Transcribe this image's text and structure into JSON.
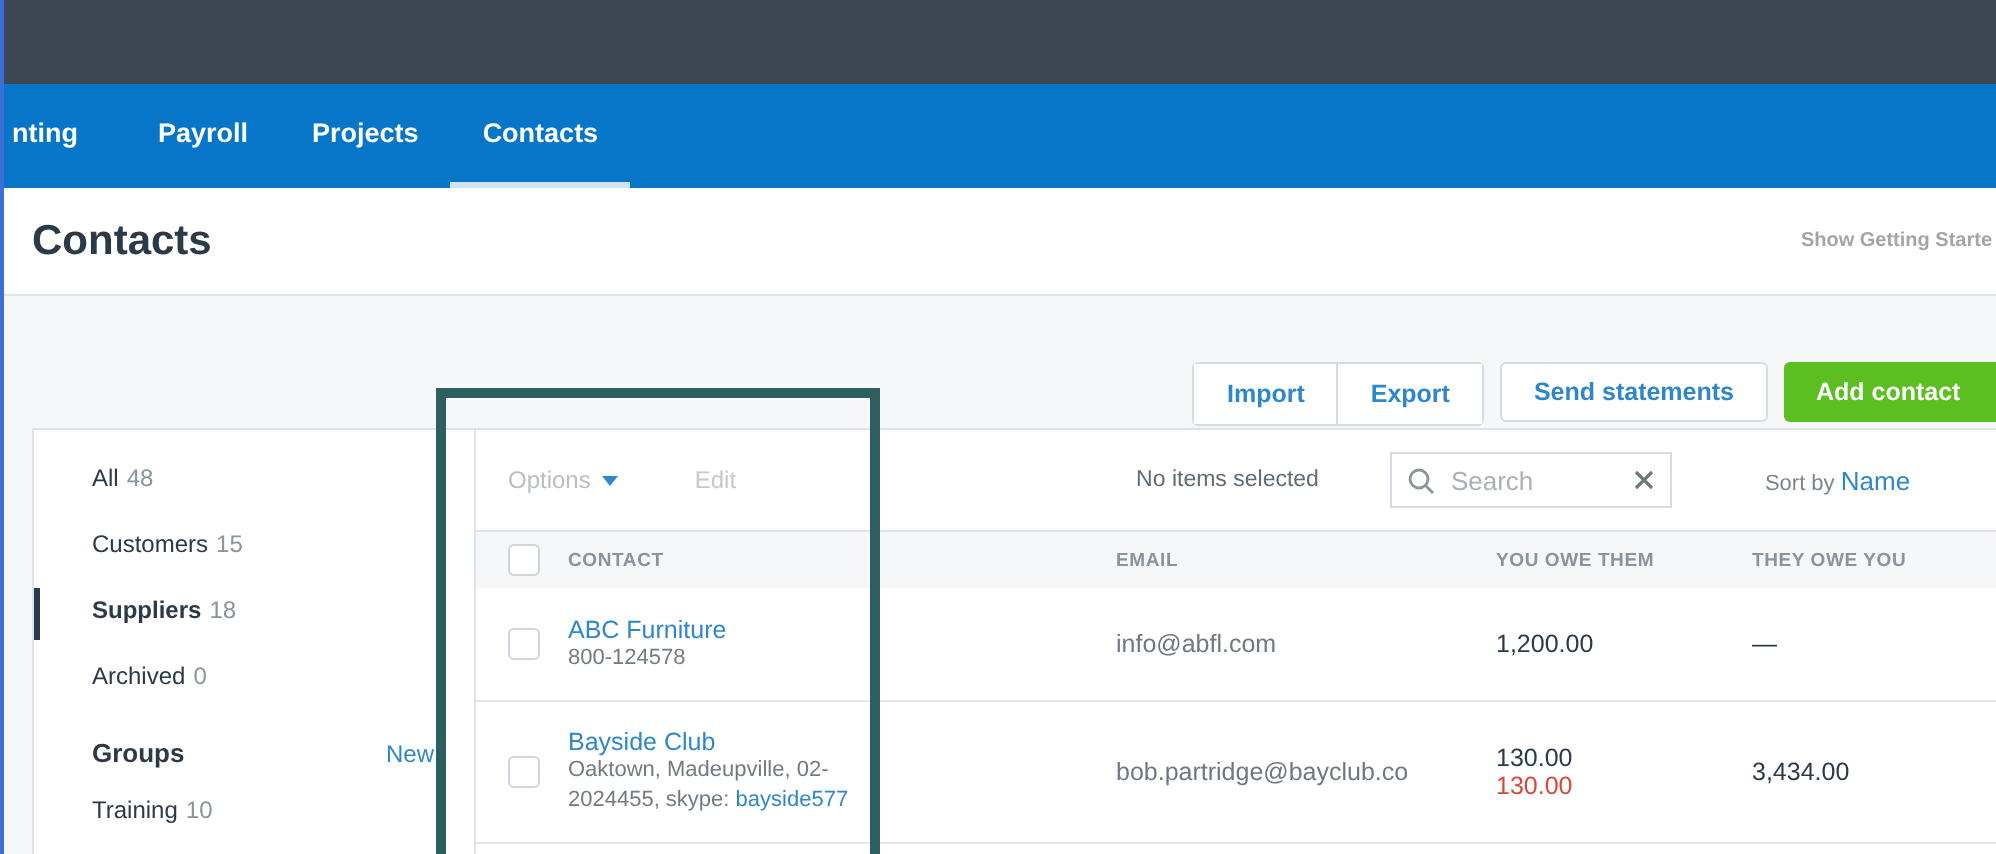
{
  "nav": {
    "tabs": [
      {
        "label": "nting",
        "selected": false
      },
      {
        "label": "Payroll",
        "selected": false
      },
      {
        "label": "Projects",
        "selected": false
      },
      {
        "label": "Contacts",
        "selected": true
      }
    ]
  },
  "header": {
    "title": "Contacts",
    "getting_started": "Show Getting Starte"
  },
  "actions": {
    "import": "Import",
    "export": "Export",
    "send_statements": "Send statements",
    "add_contact": "Add contact"
  },
  "sidebar": {
    "items": [
      {
        "label": "All",
        "count": "48",
        "selected": false
      },
      {
        "label": "Customers",
        "count": "15",
        "selected": false
      },
      {
        "label": "Suppliers",
        "count": "18",
        "selected": true
      },
      {
        "label": "Archived",
        "count": "0",
        "selected": false
      }
    ],
    "groups_title": "Groups",
    "new_link": "New",
    "groups": [
      {
        "label": "Training",
        "count": "10"
      }
    ]
  },
  "toolbar": {
    "options": "Options",
    "edit": "Edit",
    "edit_disabled": true,
    "selection": "No items selected",
    "search": {
      "placeholder": "Search"
    },
    "sort_label": "Sort by",
    "sort_value": "Name"
  },
  "table": {
    "select_all_checked": false,
    "columns": [
      "CONTACT",
      "EMAIL",
      "YOU OWE THEM",
      "THEY OWE YOU"
    ],
    "rows": [
      {
        "name": "ABC Furniture",
        "detail": "800-124578",
        "checked": false,
        "email": "info@abfl.com",
        "you_owe": "1,200.00",
        "they_owe": "—"
      },
      {
        "name": "Bayside Club",
        "detail": "Oaktown, Madeupville, 02-2024455, skype:",
        "skype": "bayside577",
        "checked": false,
        "email": "bob.partridge@bayclub.co",
        "you_owe": "130.00",
        "you_owe_overdue": "130.00",
        "they_owe": "3,434.00"
      }
    ]
  }
}
